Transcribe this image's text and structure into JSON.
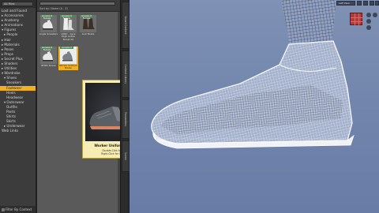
{
  "tree": {
    "dropdown": "All Files",
    "items": [
      {
        "label": "Lost and Found",
        "indent": 0,
        "selected": false
      },
      {
        "label": "▸ Accessories",
        "indent": 0,
        "selected": false
      },
      {
        "label": "▸ Anatomy",
        "indent": 0,
        "selected": false
      },
      {
        "label": "▸ Animations",
        "indent": 0,
        "selected": false
      },
      {
        "label": "▾ Figures",
        "indent": 0,
        "selected": false
      },
      {
        "label": "▸ People",
        "indent": 1,
        "selected": false
      },
      {
        "label": "▸ Hair",
        "indent": 0,
        "selected": false
      },
      {
        "label": "▸ Materials",
        "indent": 0,
        "selected": false
      },
      {
        "label": "▸ Poses",
        "indent": 0,
        "selected": false
      },
      {
        "label": "▸ Props",
        "indent": 0,
        "selected": false
      },
      {
        "label": "▸ Secret Plus",
        "indent": 0,
        "selected": false
      },
      {
        "label": "▸ Shaders",
        "indent": 0,
        "selected": false
      },
      {
        "label": "▸ Utilities",
        "indent": 0,
        "selected": false
      },
      {
        "label": "▾ Wardrobe",
        "indent": 0,
        "selected": false
      },
      {
        "label": "▾ Shoes",
        "indent": 1,
        "selected": false
      },
      {
        "label": "Sneakers",
        "indent": 2,
        "selected": false
      },
      {
        "label": "Footwear",
        "indent": 2,
        "selected": true
      },
      {
        "label": "Heels",
        "indent": 2,
        "selected": false
      },
      {
        "label": "Headwear",
        "indent": 2,
        "selected": false
      },
      {
        "label": "▾ Outerwear",
        "indent": 1,
        "selected": false
      },
      {
        "label": "Outfits",
        "indent": 2,
        "selected": false
      },
      {
        "label": "Pants",
        "indent": 2,
        "selected": false
      },
      {
        "label": "Shirts",
        "indent": 2,
        "selected": false
      },
      {
        "label": "Skirts",
        "indent": 2,
        "selected": false
      },
      {
        "label": "▸ Underwear",
        "indent": 1,
        "selected": false
      },
      {
        "label": "Web Links",
        "indent": 0,
        "selected": false
      }
    ],
    "footer": "Filter By Context"
  },
  "content": {
    "sort_label": "Sort by: Name (A - Z)",
    "thumbs": [
      {
        "label": "Angle Sneakers",
        "badge": "Genesis 8 Female",
        "selected": false
      },
      {
        "label": "LMSC - Lace High Anthe Boost 20",
        "badge": "Genesis 8 Female",
        "selected": false
      },
      {
        "label": "Link Boots",
        "badge": "Genesis 8 Female",
        "selected": false
      },
      {
        "label": "BHRS Shoes",
        "badge": "Genesis 8 Female",
        "selected": false
      },
      {
        "label": "Worker Uniform Boots",
        "badge": "Genesis 8 Female",
        "selected": true
      }
    ]
  },
  "tooltip": {
    "title": "Worker Uniform Boots",
    "line1": "Double-Click to Load",
    "line2": "Right-Click for Options"
  },
  "tabs": [
    "Smart Content",
    "Content Library",
    "Parameters",
    "Scene"
  ],
  "viewport": {
    "camera": "Left View",
    "mode": "Wire Shaded"
  }
}
